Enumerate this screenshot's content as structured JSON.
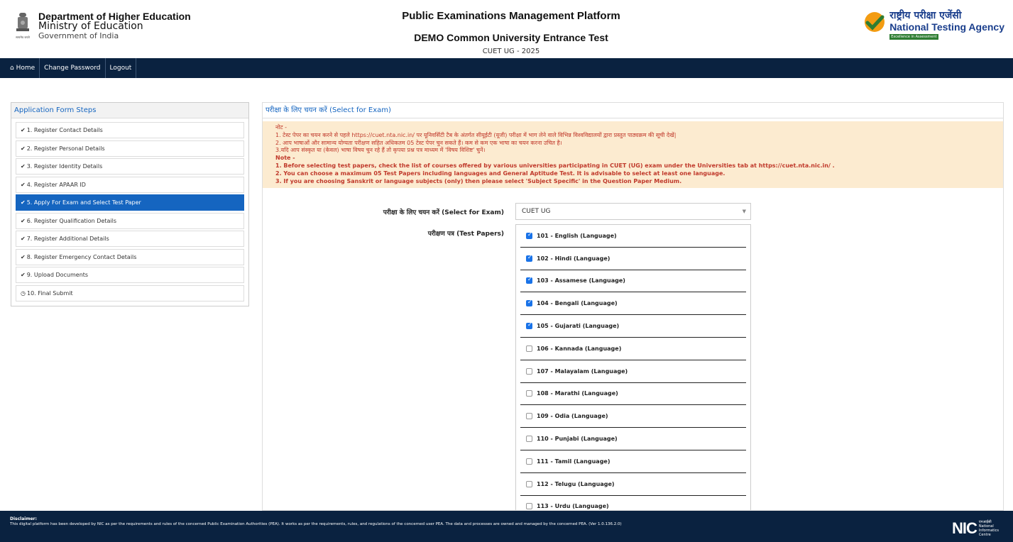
{
  "header": {
    "dept_title": "Department of Higher Education",
    "ministry": "Ministry of Education",
    "gov": "Government of India",
    "emblem_motto": "सत्यमेव जयते",
    "platform": "Public Examinations Management Platform",
    "exam_title": "DEMO Common University Entrance Test",
    "exam_year": "CUET UG - 2025",
    "nta_hindi": "राष्ट्रीय परीक्षा एजेंसी",
    "nta_english": "National Testing Agency",
    "nta_tag": "Excellence in Assessment"
  },
  "nav": {
    "home": "Home",
    "change_password": "Change Password",
    "logout": "Logout"
  },
  "sidebar": {
    "title": "Application Form Steps",
    "steps": [
      {
        "label": "1. Register Contact Details",
        "icon": "check-circle"
      },
      {
        "label": "2. Register Personal Details",
        "icon": "check-circle"
      },
      {
        "label": "3. Register Identity Details",
        "icon": "check-circle"
      },
      {
        "label": "4. Register APAAR ID",
        "icon": "check-circle"
      },
      {
        "label": "5. Apply For Exam and Select Test Paper",
        "icon": "check-circle"
      },
      {
        "label": "6. Register Qualification Details",
        "icon": "check-circle"
      },
      {
        "label": "7. Register Additional Details",
        "icon": "check-circle"
      },
      {
        "label": "8. Register Emergency Contact Details",
        "icon": "check-circle"
      },
      {
        "label": "9. Upload Documents",
        "icon": "check-circle"
      },
      {
        "label": "10. Final Submit",
        "icon": "clock"
      }
    ]
  },
  "main": {
    "title": "परीक्षा के लिए चयन करें (Select for Exam)",
    "note_hi_head": "नोट -",
    "note_hi_1": "1. टेस्ट पेपर का चयन करने से पहले https://cuet.nta.nic.in/ पर यूनिवर्सिटी टैब के अंतर्गत सीयूईटी (यूजी) परीक्षा में भाग लेने वाले विभिन्न विश्वविद्यालयों द्वारा प्रस्तुत पाठ्यक्रम की सूची देखें|",
    "note_hi_2": "2. आप भाषाओं और सामान्य योग्यता परीक्षण सहित अधिकतम 05 टेस्ट पेपर चुन सकते हैं। कम से कम एक भाषा का चयन करना उचित है।",
    "note_hi_3": "3.यदि आप संस्कृत या (केवल) भाषा विषय चुन रहे हैं तो कृपया प्रश्न पत्र माध्यम में 'विषय विशिष्ट' चुनें।",
    "note_en_head": "Note -",
    "note_en_1": "1. Before selecting test papers, check the list of courses offered by various universities participating in CUET (UG) exam under the Universities tab at https://cuet.nta.nic.in/ .",
    "note_en_2": "2. You can choose a maximum 05 Test Papers including languages and General Aptitude Test. It is advisable to select at least one language.",
    "note_en_3": "3. If you are choosing Sanskrit or language subjects (only) then please select 'Subject Specific' in the Question Paper Medium.",
    "select_label": "परीक्षा के लिए चयन करें (Select for Exam)",
    "select_value": "CUET UG",
    "papers_label": "परीक्षण पत्र (Test Papers)",
    "papers": [
      {
        "label": "101 - English (Language)",
        "checked": true
      },
      {
        "label": "102 - Hindi (Language)",
        "checked": true
      },
      {
        "label": "103 - Assamese (Language)",
        "checked": true
      },
      {
        "label": "104 - Bengali (Language)",
        "checked": true
      },
      {
        "label": "105 - Gujarati (Language)",
        "checked": true
      },
      {
        "label": "106 - Kannada (Language)",
        "checked": false
      },
      {
        "label": "107 - Malayalam (Language)",
        "checked": false
      },
      {
        "label": "108 - Marathi (Language)",
        "checked": false
      },
      {
        "label": "109 - Odia (Language)",
        "checked": false
      },
      {
        "label": "110 - Punjabi (Language)",
        "checked": false
      },
      {
        "label": "111 - Tamil (Language)",
        "checked": false
      },
      {
        "label": "112 - Telugu (Language)",
        "checked": false
      },
      {
        "label": "113 - Urdu (Language)",
        "checked": false
      }
    ]
  },
  "footer": {
    "disclaimer_title": "Disclaimer:",
    "disclaimer_text": "This digital platform has been developed by NIC as per the requirements and rules of the concerned Public Examination Authorities (PEA). It works as per the requirements, rules, and regulations of the concerned user PEA. The data and processes are owned and managed by the concerned PEA. (Ver 1.0.136.2.0)",
    "nic_logo": "NIC",
    "nic_hindi": "एनआईसी",
    "nic_name_1": "National",
    "nic_name_2": "Informatics",
    "nic_name_3": "Centre"
  },
  "colors": {
    "navbar": "#0a2240",
    "accent": "#1565c0",
    "note_bg": "#fcebd0",
    "note_text": "#c0392b",
    "checkbox": "#1a73e8"
  }
}
